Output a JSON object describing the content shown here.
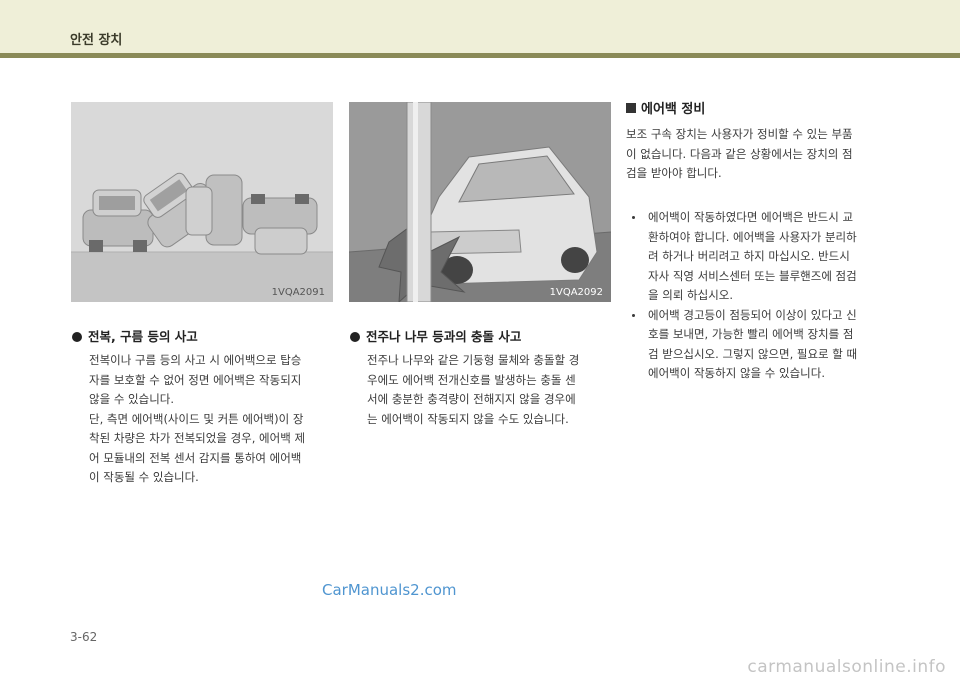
{
  "header": {
    "title": "안전 장치"
  },
  "figures": [
    {
      "code": "1VQA2091"
    },
    {
      "code": "1VQA2092"
    }
  ],
  "rollover": {
    "heading": "전복, 구름 등의 사고",
    "lines": [
      "전복이나 구름 등의 사고 시 에어백으로 탑승",
      "자를 보호할 수 없어 정면 에어백은 작동되지",
      "않을 수 있습니다.",
      "단, 측면 에어백(사이드 및 커튼 에어백)이 장",
      "착된 차량은 차가 전복되었을 경우, 에어백 제",
      "어 모듈내의 전복 센서 감지를 통하여 에어백",
      "이 작동될 수 있습니다."
    ]
  },
  "pole": {
    "heading": "전주나 나무 등과의 충돌 사고",
    "lines": [
      "전주나 나무와 같은 기둥형 물체와 충돌할 경",
      "우에도 에어백 전개신호를 발생하는 충돌 센",
      "서에 충분한 충격량이 전해지지 않을 경우에",
      "는 에어백이 작동되지 않을 수도 있습니다."
    ]
  },
  "maintenance": {
    "heading": "에어백 정비",
    "intro": [
      "보조 구속 장치는 사용자가 정비할 수 있는 부품",
      "이 없습니다. 다음과 같은 상황에서는 장치의 점",
      "검을 받아야 합니다."
    ],
    "items": [
      {
        "lines": [
          "에어백이 작동하였다면 에어백은 반드시 교",
          "환하여야 합니다. 에어백을 사용자가 분리하",
          "려 하거나 버리려고 하지 마십시오. 반드시",
          "자사 직영 서비스센터 또는 블루핸즈에 점검",
          "을 의뢰 하십시오."
        ]
      },
      {
        "lines": [
          "에어백 경고등이 점등되어 이상이 있다고 신",
          "호를 보내면, 가능한 빨리 에어백 장치를 점",
          "검 받으십시오. 그렇지 않으면, 필요로 할 때",
          "에어백이 작동하지 않을 수 있습니다."
        ]
      }
    ]
  },
  "watermark": "CarManuals2.com",
  "page_number": "3-62",
  "footer_url": "carmanualsonline.info"
}
